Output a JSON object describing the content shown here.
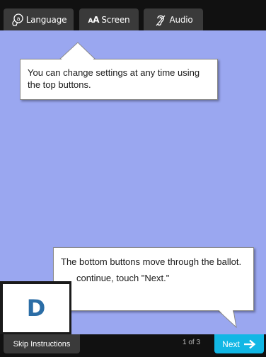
{
  "top_buttons": {
    "language": {
      "label": "Language",
      "icon": "language-icon"
    },
    "screen": {
      "label": "Screen",
      "icon_text_large": "A",
      "icon_text_small": "A"
    },
    "audio": {
      "label": "Audio",
      "icon": "ear-icon"
    }
  },
  "tooltips": {
    "top": {
      "text": "You can change settings at any time using the top buttons."
    },
    "bottom": {
      "line1": "The bottom buttons move through the ballot.",
      "line2": "continue, touch \"Next.\""
    }
  },
  "marker": {
    "letter": "D",
    "color": "#2b6da6"
  },
  "bottom_bar": {
    "skip_label": "Skip Instructions",
    "page_indicator": "1 of 3",
    "next_label": "Next"
  },
  "colors": {
    "background": "#9aa7f0",
    "bar": "#111111",
    "button": "#3a3a3a",
    "next_button": "#12b7e5"
  }
}
